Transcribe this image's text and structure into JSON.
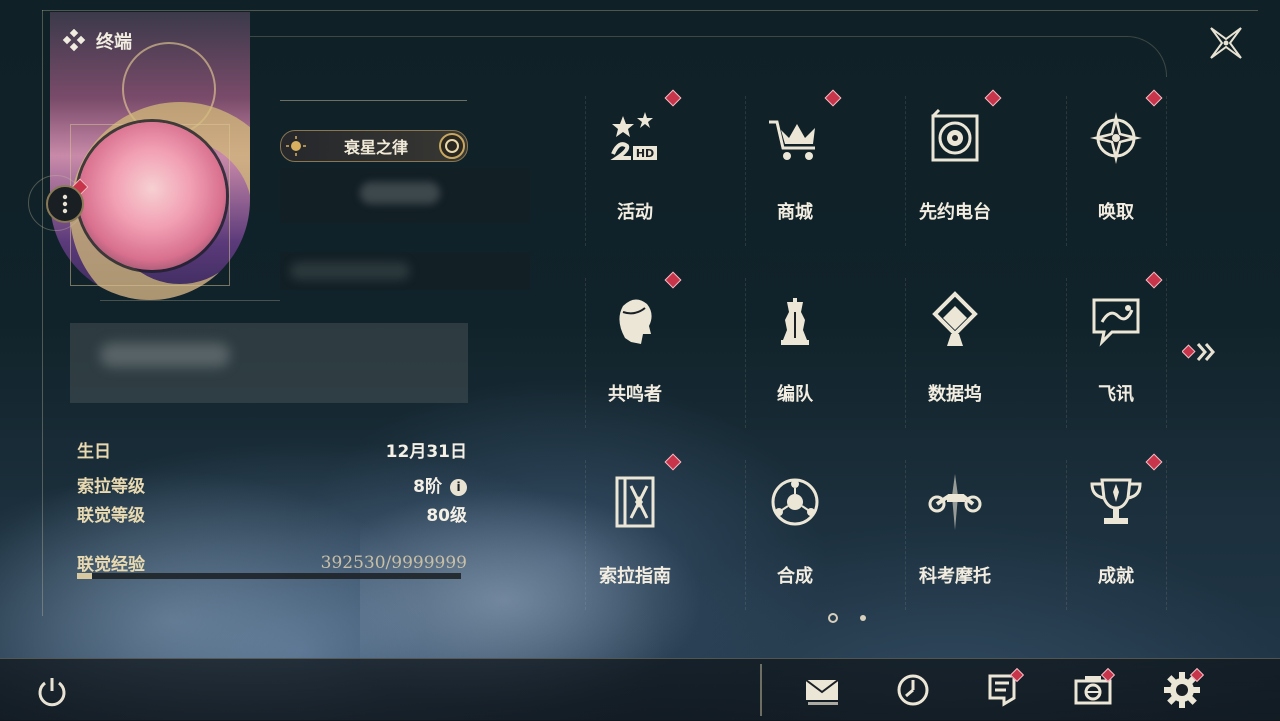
{
  "header": {
    "title": "终端",
    "title_icon": "diamond-cluster-icon",
    "close_icon": "close-x-icon"
  },
  "profile": {
    "name_plate": "衰星之律",
    "menu_icon": "more-vertical-icon"
  },
  "stats": {
    "birthday_label": "生日",
    "birthday_value": "12月31日",
    "sola_level_label": "索拉等级",
    "sola_level_value": "8阶",
    "info_icon_text": "i",
    "union_level_label": "联觉等级",
    "union_level_value": "80级",
    "union_exp_label": "联觉经验",
    "union_exp_value": "392530/9999999",
    "union_exp_progress": 0.0393
  },
  "grid": {
    "rows": [
      [
        {
          "label": "活动",
          "icon": "2hd-stars-icon",
          "badge": true
        },
        {
          "label": "商城",
          "icon": "crown-cart-icon",
          "badge": true
        },
        {
          "label": "先约电台",
          "icon": "radio-speaker-icon",
          "badge": true
        },
        {
          "label": "唤取",
          "icon": "compass-star-icon",
          "badge": true
        }
      ],
      [
        {
          "label": "共鸣者",
          "icon": "character-head-icon",
          "badge": true
        },
        {
          "label": "编队",
          "icon": "chess-pieces-icon",
          "badge": false
        },
        {
          "label": "数据坞",
          "icon": "data-dock-icon",
          "badge": false
        },
        {
          "label": "飞讯",
          "icon": "chat-bubble-icon",
          "badge": true
        }
      ],
      [
        {
          "label": "索拉指南",
          "icon": "guide-book-icon",
          "badge": true
        },
        {
          "label": "合成",
          "icon": "synthesis-orb-icon",
          "badge": false
        },
        {
          "label": "科考摩托",
          "icon": "motorcycle-icon",
          "badge": false
        },
        {
          "label": "成就",
          "icon": "trophy-icon",
          "badge": true
        }
      ]
    ],
    "next_page_icon": "double-chevron-right-icon",
    "current_page": 1,
    "total_pages": 2
  },
  "bottom_bar": {
    "power_icon": "power-icon",
    "buttons": [
      {
        "icon": "mail-icon",
        "badge": false
      },
      {
        "icon": "clock-icon",
        "badge": false
      },
      {
        "icon": "notes-icon",
        "badge": true
      },
      {
        "icon": "camera-icon",
        "badge": true
      },
      {
        "icon": "settings-gear-icon",
        "badge": true
      }
    ]
  },
  "colors": {
    "accent_gold": "#d8c9a0",
    "badge_red": "#c8344a",
    "text_light": "#f2ede0"
  }
}
